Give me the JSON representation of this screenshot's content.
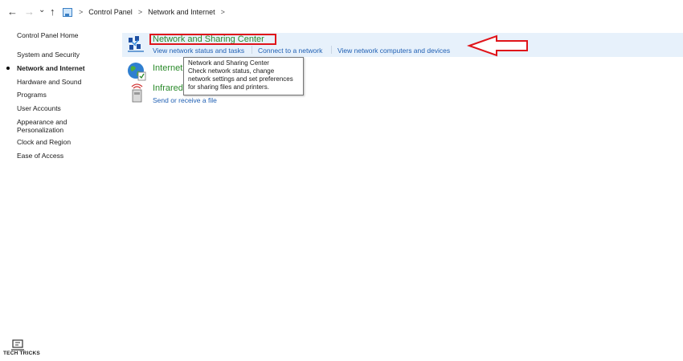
{
  "address_bar": {
    "back_glyph": "←",
    "forward_glyph": "→",
    "recent_glyph": "⌄",
    "up_glyph": "↑",
    "separator": ">",
    "breadcrumbs": [
      "Control Panel",
      "Network and Internet"
    ]
  },
  "sidebar": {
    "items": [
      {
        "label": "Control Panel Home"
      },
      {
        "label": "System and Security"
      },
      {
        "label": "Network and Internet",
        "active": true
      },
      {
        "label": "Hardware and Sound"
      },
      {
        "label": "Programs"
      },
      {
        "label": "User Accounts"
      },
      {
        "label": "Appearance and"
      },
      {
        "label": "Personalization"
      },
      {
        "label": "Clock and Region"
      },
      {
        "label": "Ease of Access"
      }
    ]
  },
  "categories": [
    {
      "icon": "network-sharing-center-icon",
      "title": "Network and Sharing Center",
      "links": [
        "View network status and tasks",
        "Connect to a network",
        "View network computers and devices"
      ]
    },
    {
      "icon": "internet-options-globe-icon",
      "title": "Internet",
      "links": []
    },
    {
      "icon": "infrared-icon",
      "title": "Infrared",
      "links": [
        "Send or receive a file"
      ]
    }
  ],
  "tooltip": {
    "lines": [
      "Network and Sharing Center",
      "Check network status, change",
      "network settings and set preferences",
      "for sharing files and printers."
    ]
  },
  "annotation": {
    "highlight_color": "#e0141a",
    "arrow_color": "#e0141a"
  },
  "watermark": {
    "text": "TECH TRICKS"
  }
}
